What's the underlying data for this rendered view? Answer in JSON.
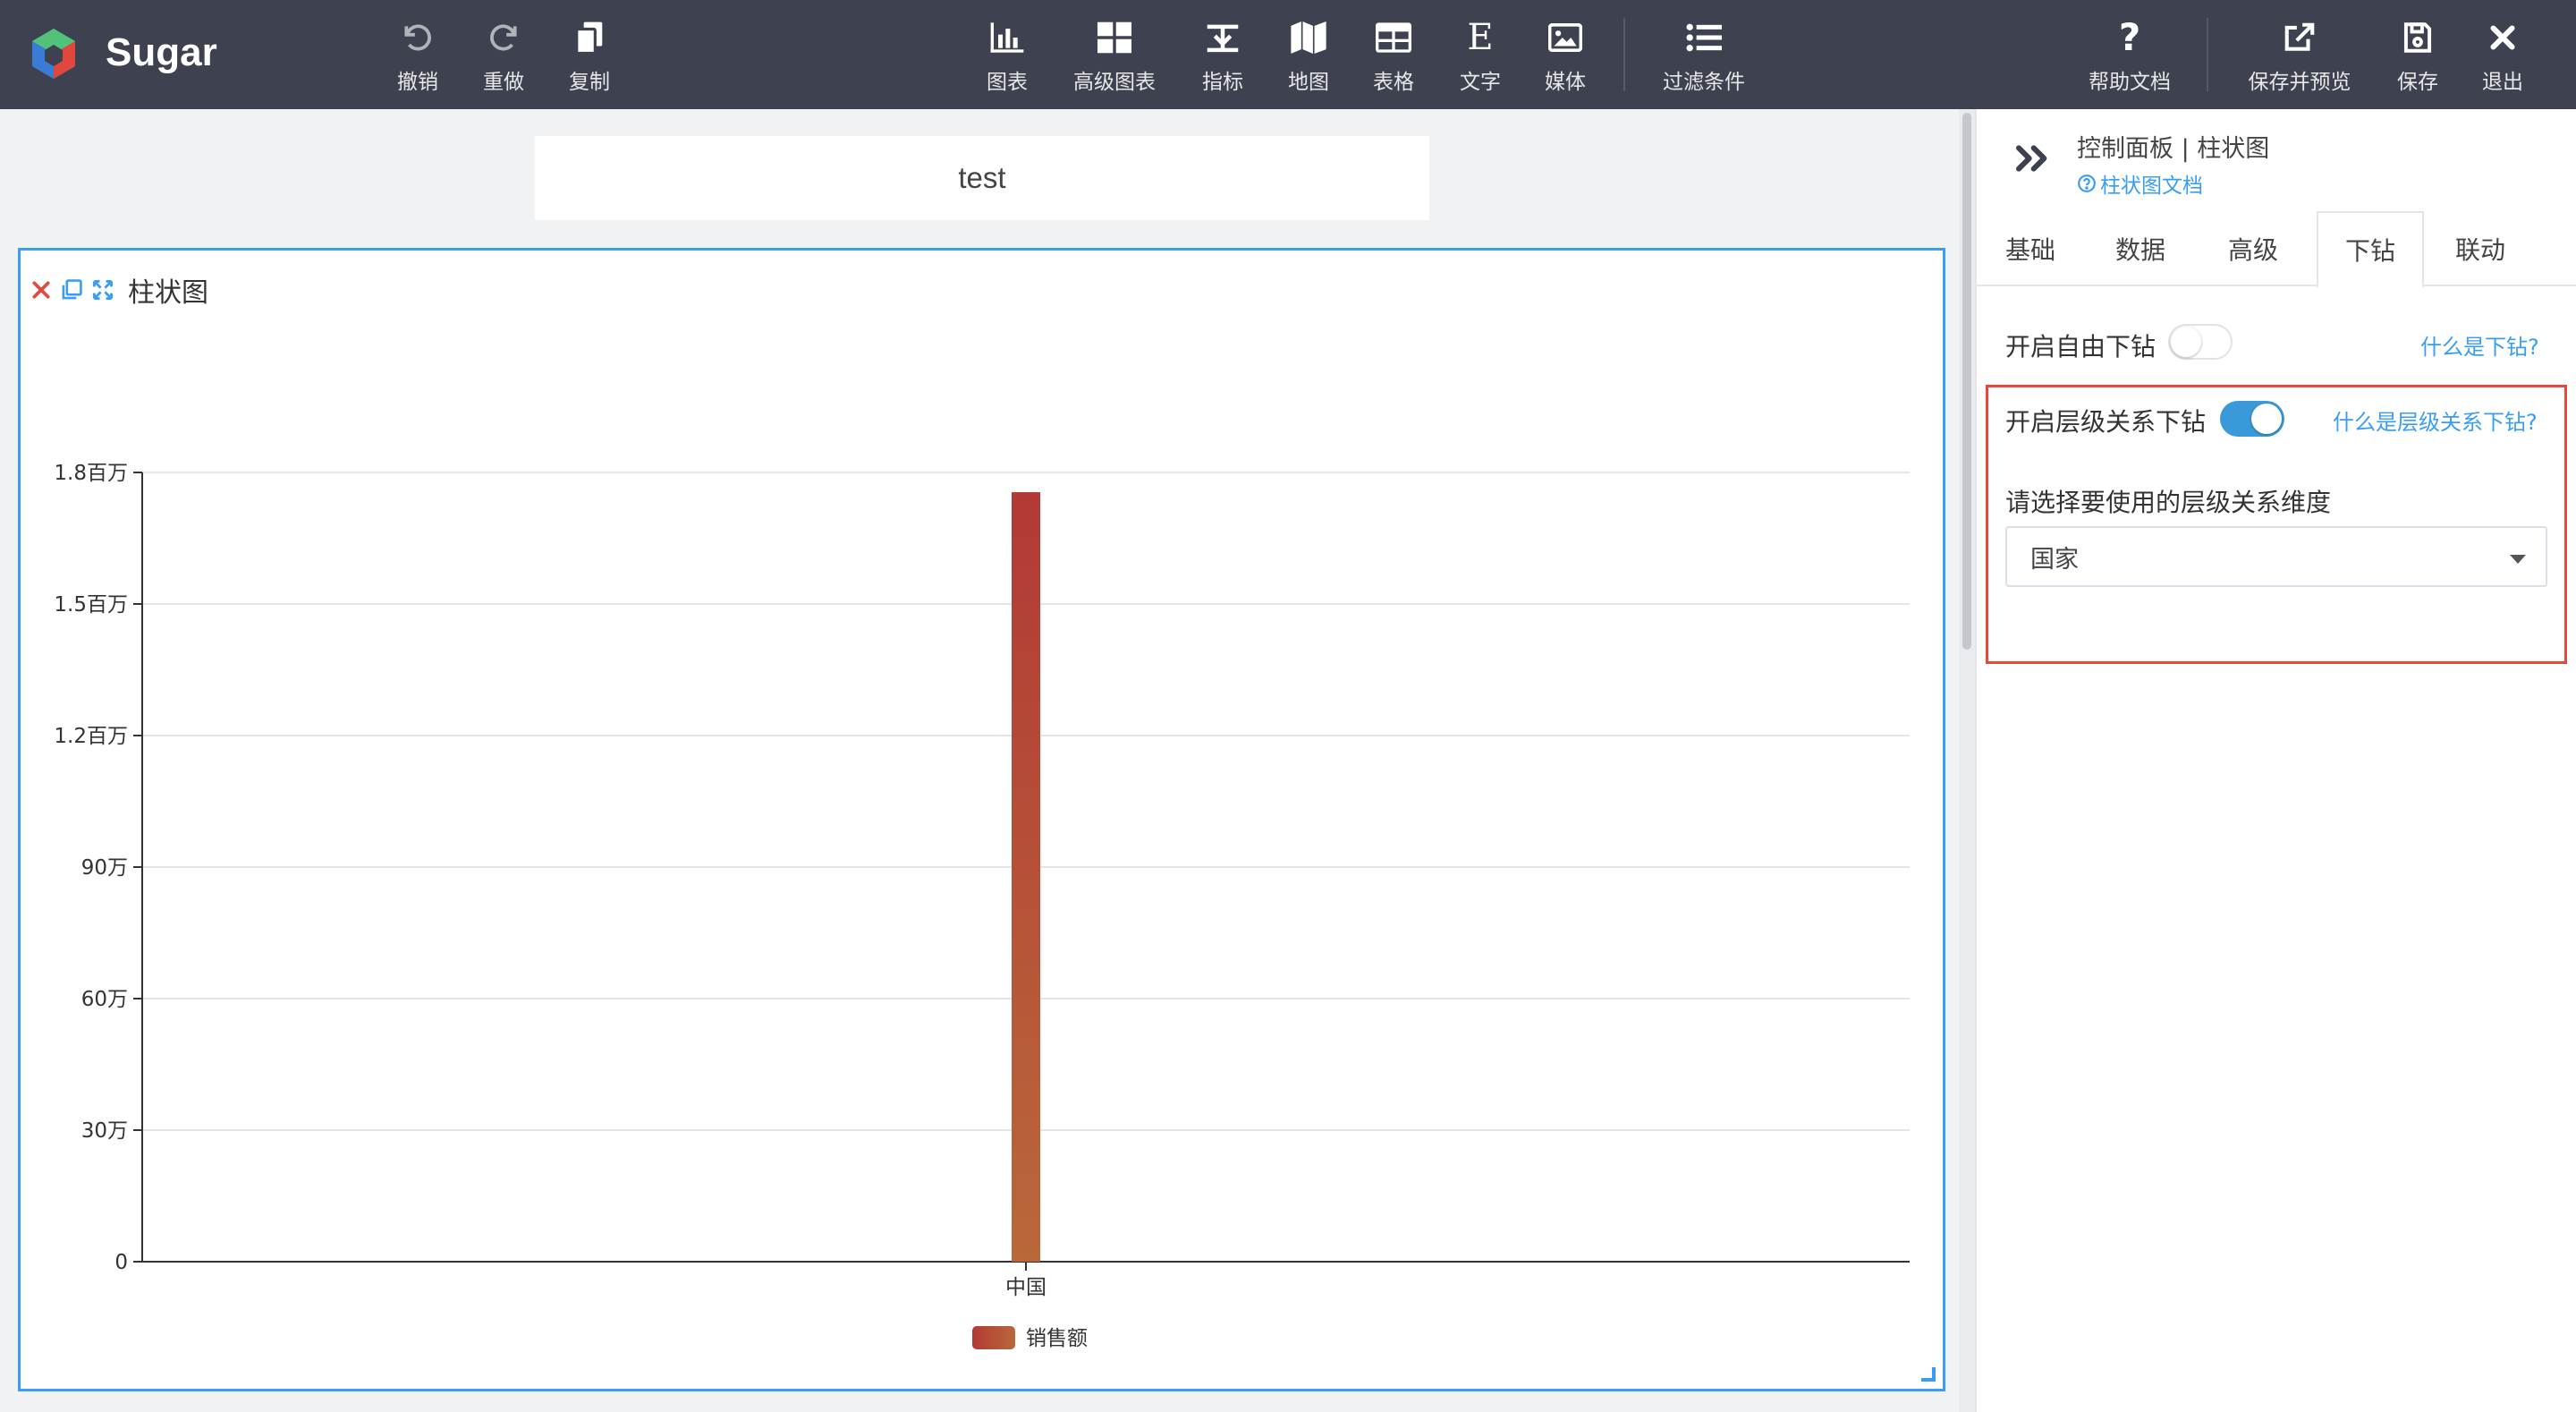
{
  "app": {
    "brand": "Sugar"
  },
  "toolbar": {
    "left": [
      {
        "id": "undo",
        "label": "撤销",
        "icon": "undo-icon"
      },
      {
        "id": "redo",
        "label": "重做",
        "icon": "redo-icon"
      },
      {
        "id": "copy",
        "label": "复制",
        "icon": "copy-icon"
      }
    ],
    "center": [
      {
        "id": "chart",
        "label": "图表",
        "icon": "bar-chart-icon"
      },
      {
        "id": "adv-chart",
        "label": "高级图表",
        "icon": "grid-icon"
      },
      {
        "id": "metric",
        "label": "指标",
        "icon": "metric-icon"
      },
      {
        "id": "map",
        "label": "地图",
        "icon": "map-icon"
      },
      {
        "id": "table",
        "label": "表格",
        "icon": "table-icon"
      },
      {
        "id": "text",
        "label": "文字",
        "icon": "text-icon"
      },
      {
        "id": "media",
        "label": "媒体",
        "icon": "image-icon"
      },
      {
        "id": "filter",
        "label": "过滤条件",
        "icon": "list-icon"
      }
    ],
    "right": [
      {
        "id": "help",
        "label": "帮助文档",
        "icon": "question-icon"
      },
      {
        "id": "save-preview",
        "label": "保存并预览",
        "icon": "external-link-icon"
      },
      {
        "id": "save",
        "label": "保存",
        "icon": "save-icon"
      },
      {
        "id": "exit",
        "label": "退出",
        "icon": "close-icon"
      }
    ]
  },
  "canvas": {
    "page_title": "test",
    "widget": {
      "title": "柱状图"
    }
  },
  "chart_data": {
    "type": "bar",
    "categories": [
      "中国"
    ],
    "series": [
      {
        "name": "销售额",
        "values": [
          1755000
        ]
      }
    ],
    "ylim": [
      0,
      1800000
    ],
    "yticks": [
      {
        "value": 0,
        "label": "0"
      },
      {
        "value": 300000,
        "label": "30万"
      },
      {
        "value": 600000,
        "label": "60万"
      },
      {
        "value": 900000,
        "label": "90万"
      },
      {
        "value": 1200000,
        "label": "1.2百万"
      },
      {
        "value": 1500000,
        "label": "1.5百万"
      },
      {
        "value": 1800000,
        "label": "1.8百万"
      }
    ],
    "grid": true,
    "legend": "bottom",
    "colors": {
      "bar_top": "#b23a35",
      "bar_bottom": "#b9683a",
      "grid": "#e5e5e5",
      "axis": "#333333"
    }
  },
  "panel": {
    "title": "控制面板 | 柱状图",
    "doc_link": "柱状图文档",
    "tabs": [
      {
        "label": "基础",
        "active": false
      },
      {
        "label": "数据",
        "active": false
      },
      {
        "label": "高级",
        "active": false
      },
      {
        "label": "下钻",
        "active": true
      },
      {
        "label": "联动",
        "active": false
      }
    ],
    "free_drill": {
      "label": "开启自由下钻",
      "enabled": false,
      "help": "什么是下钻?"
    },
    "hier_drill": {
      "label": "开启层级关系下钻",
      "enabled": true,
      "help": "什么是层级关系下钻?"
    },
    "dimension_label": "请选择要使用的层级关系维度",
    "dimension_value": "国家"
  },
  "colors": {
    "topbar": "#3d4150",
    "accent": "#3a9df4",
    "highlight": "#e24a3b"
  }
}
